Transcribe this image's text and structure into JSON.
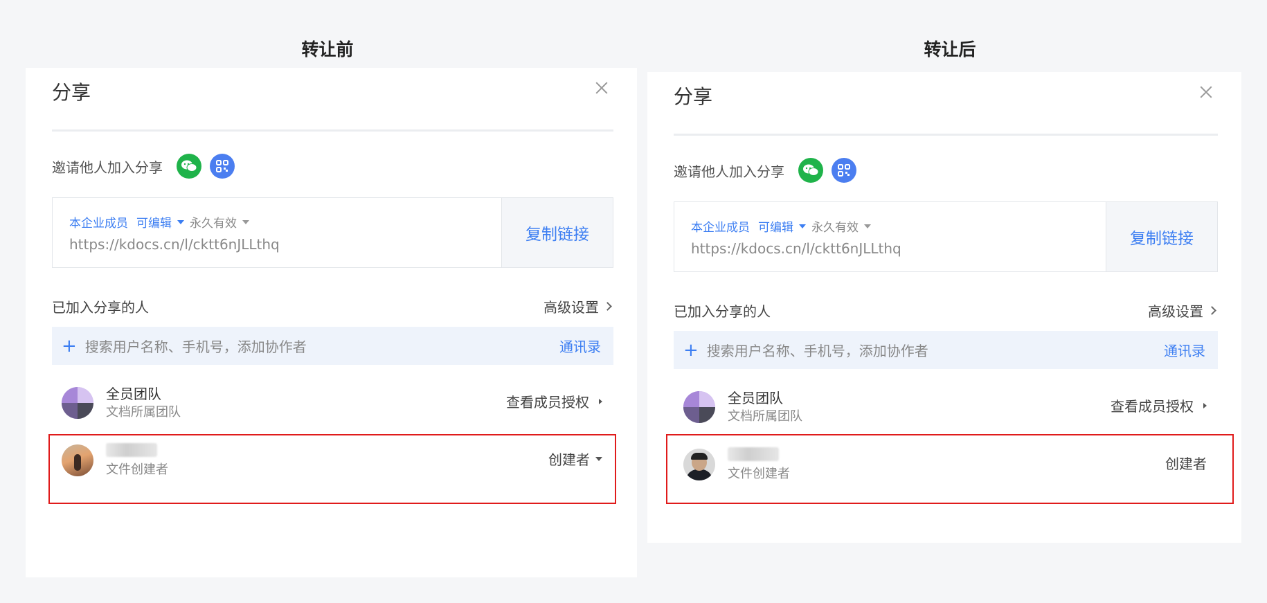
{
  "captions": {
    "before": "转让前",
    "after": "转让后"
  },
  "panels": [
    {
      "title": "分享",
      "invite_label": "邀请他人加入分享",
      "link": {
        "scope": "本企业成员",
        "permission": "可编辑",
        "expiry": "永久有效",
        "url": "https://kdocs.cn/l/cktt6nJLLthq",
        "copy_label": "复制链接"
      },
      "members_label": "已加入分享的人",
      "advanced_settings": "高级设置",
      "search_placeholder": "搜索用户名称、手机号，添加协作者",
      "contacts": "通讯录",
      "team": {
        "name": "全员团队",
        "sub": "文档所属团队",
        "action": "查看成员授权"
      },
      "creator": {
        "sub": "文件创建者",
        "role": "创建者"
      }
    },
    {
      "title": "分享",
      "invite_label": "邀请他人加入分享",
      "link": {
        "scope": "本企业成员",
        "permission": "可编辑",
        "expiry": "永久有效",
        "url": "https://kdocs.cn/l/cktt6nJLLthq",
        "copy_label": "复制链接"
      },
      "members_label": "已加入分享的人",
      "advanced_settings": "高级设置",
      "search_placeholder": "搜索用户名称、手机号，添加协作者",
      "contacts": "通讯录",
      "team": {
        "name": "全员团队",
        "sub": "文档所属团队",
        "action": "查看成员授权"
      },
      "creator": {
        "sub": "文件创建者",
        "role": "创建者"
      }
    }
  ],
  "colors": {
    "accent": "#3c7ef2",
    "wechat": "#1fb34a",
    "highlight": "#e01b1b"
  },
  "icons": [
    "close-icon",
    "wechat-icon",
    "qrcode-icon",
    "plus-icon",
    "chevron-right-icon",
    "caret-down-icon"
  ]
}
